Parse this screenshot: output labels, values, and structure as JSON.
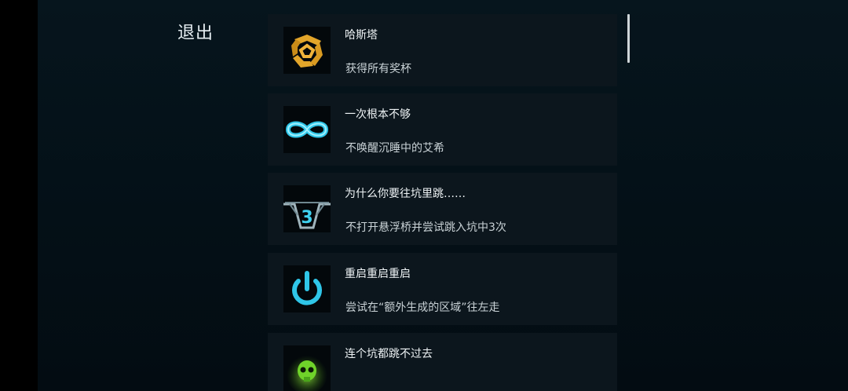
{
  "header": {
    "exit_label": "退出"
  },
  "achievements": [
    {
      "title": "哈斯塔",
      "description": "获得所有奖杯",
      "icon": "hastur-sigil-icon"
    },
    {
      "title": "一次根本不够",
      "description": "不唤醒沉睡中的艾希",
      "icon": "infinity-icon"
    },
    {
      "title": "为什么你要往坑里跳……",
      "description": "不打开悬浮桥并尝试跳入坑中3次",
      "icon": "pit-bridge-3-icon",
      "icon_text": "3"
    },
    {
      "title": "重启重启重启",
      "description": "尝试在“额外生成的区域”往左走",
      "icon": "power-icon"
    },
    {
      "title": "连个坑都跳不过去",
      "description": "",
      "icon": "green-skull-icon"
    }
  ],
  "colors": {
    "background": "#041017",
    "card": "#0c161d",
    "accent_cyan": "#2fc6e8",
    "gold": "#e2a52a",
    "green": "#6fd32a"
  }
}
